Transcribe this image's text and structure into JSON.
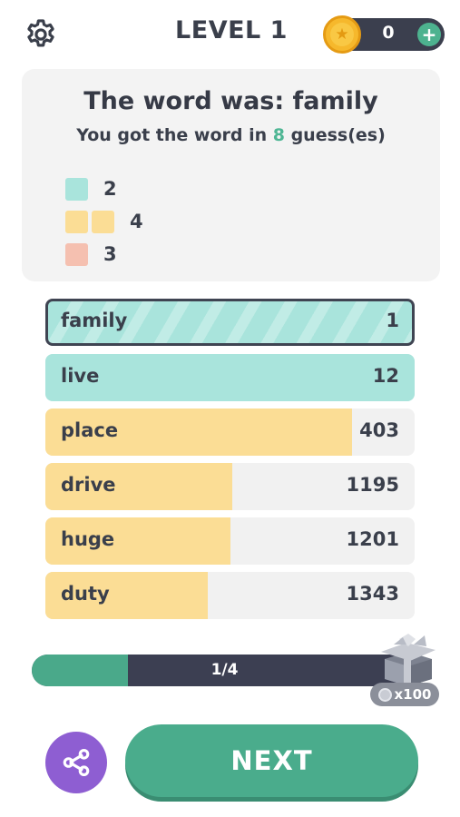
{
  "header": {
    "level_label": "LEVEL 1",
    "coins": "0",
    "add_label": "+"
  },
  "result": {
    "title": "The word was: family",
    "sub_prefix": "You got the word in ",
    "guess_count": "8",
    "sub_suffix": " guess(es)",
    "legend": [
      {
        "color": "teal",
        "squares": 1,
        "count": "2"
      },
      {
        "color": "yellow",
        "squares": 2,
        "count": "4"
      },
      {
        "color": "pink",
        "squares": 1,
        "count": "3"
      }
    ]
  },
  "guesses": [
    {
      "word": "family",
      "rank": "1",
      "fill_fraction": 1.0,
      "color": "teal",
      "best": true
    },
    {
      "word": "live",
      "rank": "12",
      "fill_fraction": 1.0,
      "color": "teal",
      "best": false
    },
    {
      "word": "place",
      "rank": "403",
      "fill_fraction": 0.83,
      "color": "yellow",
      "best": false
    },
    {
      "word": "drive",
      "rank": "1195",
      "fill_fraction": 0.505,
      "color": "yellow",
      "best": false
    },
    {
      "word": "huge",
      "rank": "1201",
      "fill_fraction": 0.5,
      "color": "yellow",
      "best": false
    },
    {
      "word": "duty",
      "rank": "1343",
      "fill_fraction": 0.44,
      "color": "yellow",
      "best": false
    }
  ],
  "progress": {
    "label": "1/4",
    "fraction": 0.25,
    "reward": "x100"
  },
  "actions": {
    "next_label": "NEXT",
    "share_icon": "share-icon"
  },
  "colors": {
    "teal": "#a9e4dc",
    "yellow": "#fbdd95",
    "pink": "#f5c0b0",
    "accent_green": "#4aac8c",
    "purple": "#8e5ed2",
    "dark": "#3c3f52"
  }
}
